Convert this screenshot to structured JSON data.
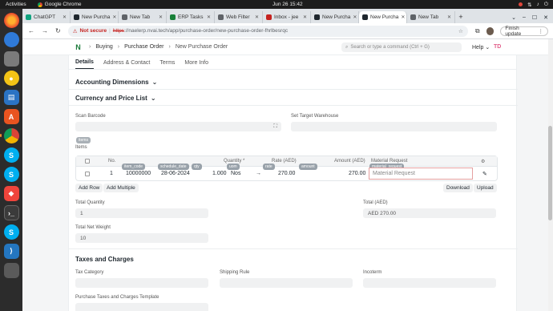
{
  "topbar": {
    "activities": "Activities",
    "app_name": "Google Chrome",
    "clock": "Jun 26  15:42"
  },
  "browser": {
    "tabs": [
      {
        "label": "ChatGPT",
        "color": "#10a37f"
      },
      {
        "label": "New Purcha",
        "color": "#1f272e"
      },
      {
        "label": "New Tab",
        "color": "#5f6368"
      },
      {
        "label": "ERP Tasks",
        "color": "#188038"
      },
      {
        "label": "Web Filter",
        "color": "#5f6368"
      },
      {
        "label": "Inbox - jee",
        "color": "#c5221f"
      },
      {
        "label": "New Purcha",
        "color": "#1f272e"
      },
      {
        "label": "New Purcha",
        "color": "#1f272e"
      },
      {
        "label": "New Tab",
        "color": "#5f6368"
      }
    ],
    "not_secure": "Not secure",
    "url_proto": "https",
    "url_rest": "://naelerp.nvai.tech/app/purchase-order/new-purchase-order-fhrlbesrqc",
    "finish_update": "Finish update"
  },
  "app": {
    "logo": "N",
    "breadcrumbs": [
      "Buying",
      "Purchase Order",
      "New Purchase Order"
    ],
    "search_placeholder": "Search or type a command (Ctrl + G)",
    "help": "Help",
    "user_initials": "TD",
    "form_tabs": [
      "Details",
      "Address & Contact",
      "Terms",
      "More Info"
    ],
    "sections": {
      "accounting_dimensions": "Accounting Dimensions",
      "currency_price_list": "Currency and Price List",
      "taxes_charges": "Taxes and Charges"
    },
    "scan_barcode_label": "Scan Barcode",
    "set_target_warehouse_label": "Set Target Warehouse",
    "items_badge": "items",
    "items_label": "Items",
    "grid": {
      "headers": {
        "no": "No.",
        "quantity": "Quantity *",
        "rate": "Rate (AED)",
        "amount": "Amount (AED)",
        "material_request": "Material Request"
      },
      "field_badges": {
        "item_code": "item_code",
        "schedule_date": "schedule_date",
        "qty": "qty",
        "uom": "uom",
        "rate": "rate",
        "amount": "amount",
        "material_request": "material_request"
      },
      "rows": [
        {
          "no": "1",
          "item_code": "10000000",
          "required_by": "28-06-2024",
          "quantity": "1.000",
          "uom": "Nos",
          "rate": "270.00",
          "amount": "270.00",
          "material_request_placeholder": "Material Request"
        }
      ]
    },
    "buttons": {
      "add_row": "Add Row",
      "add_multiple": "Add Multiple",
      "download": "Download",
      "upload": "Upload"
    },
    "total_quantity_label": "Total Quantity",
    "total_quantity": "1",
    "total_label": "Total (AED)",
    "total_value": "AED 270.00",
    "total_net_weight_label": "Total Net Weight",
    "total_net_weight": "10",
    "tax_category_label": "Tax Category",
    "shipping_rule_label": "Shipping Rule",
    "incoterm_label": "Incoterm",
    "taxes_template_label": "Purchase Taxes and Charges Template"
  }
}
